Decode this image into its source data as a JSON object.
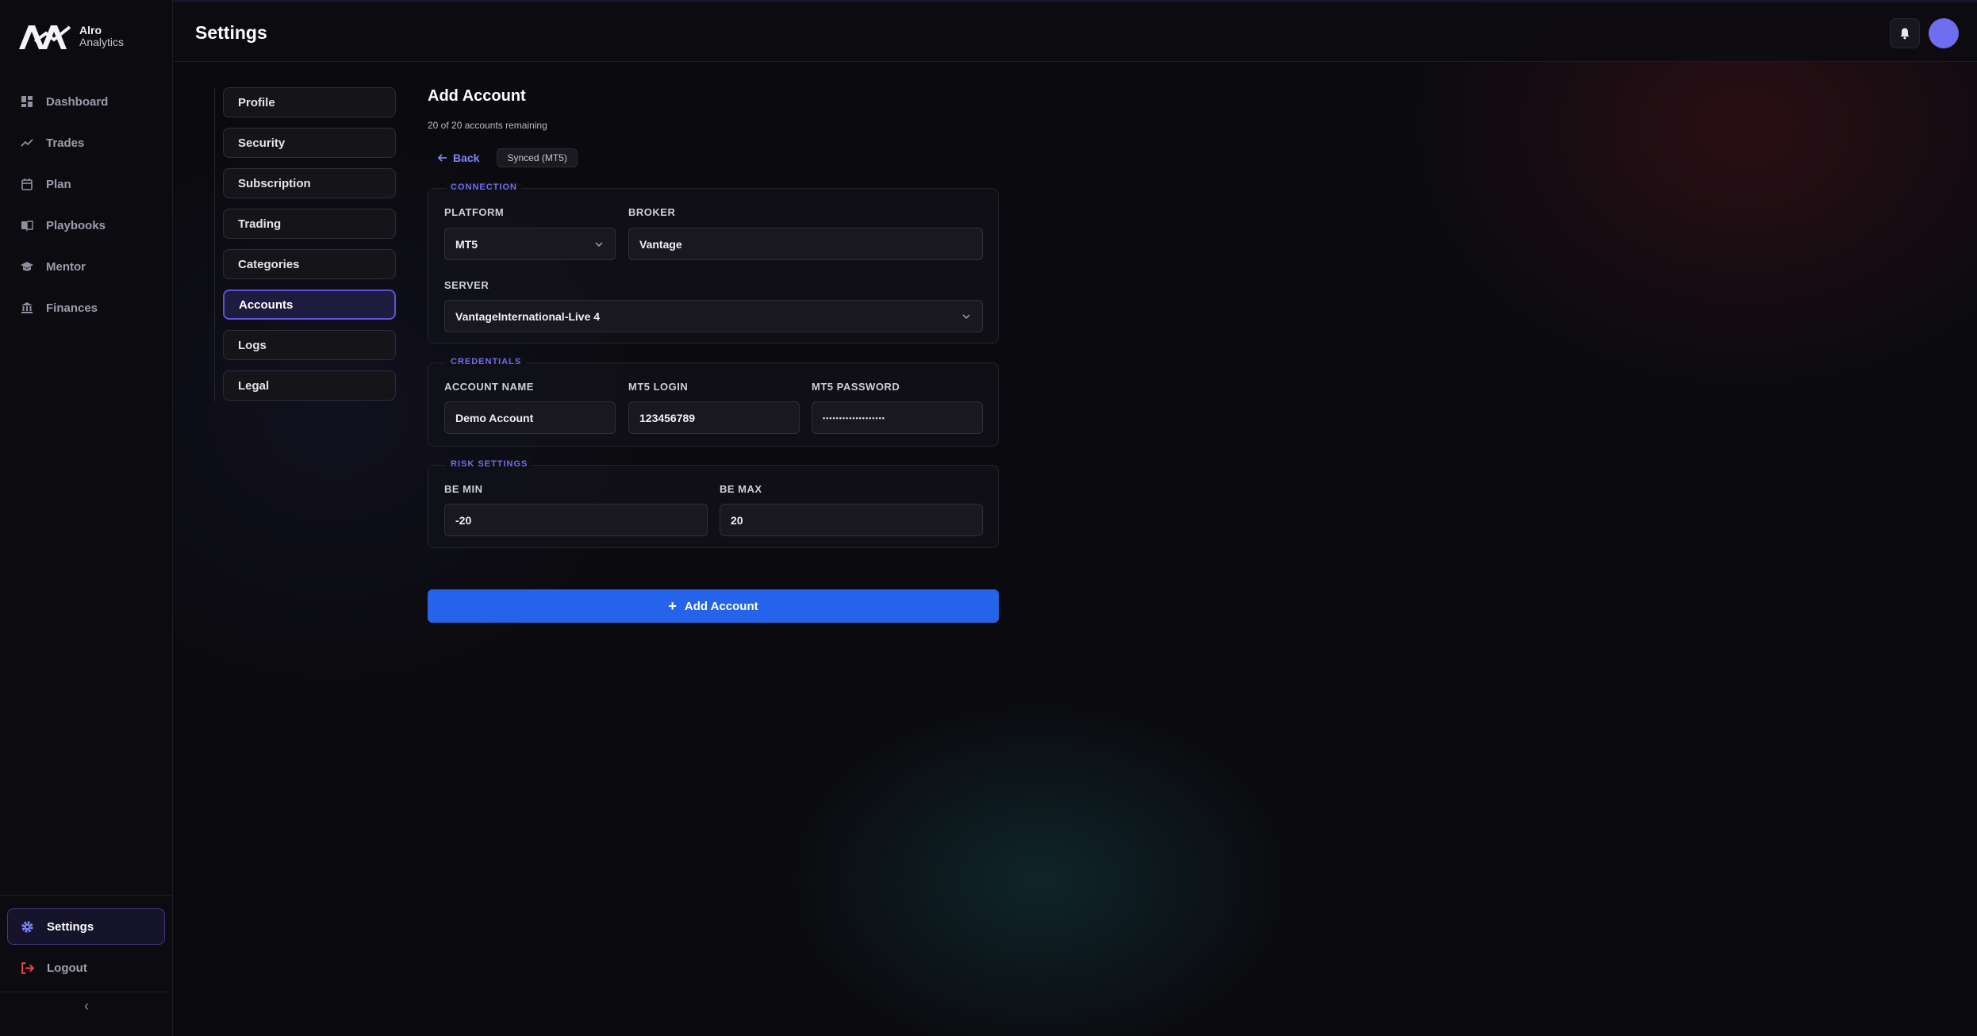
{
  "app": {
    "logo_line1": "Alro",
    "logo_line2": "Analytics",
    "page_title": "Settings"
  },
  "sidebar": {
    "items": [
      {
        "label": "Dashboard",
        "icon": "dashboard-icon"
      },
      {
        "label": "Trades",
        "icon": "trend-icon"
      },
      {
        "label": "Plan",
        "icon": "calendar-icon"
      },
      {
        "label": "Playbooks",
        "icon": "book-icon"
      },
      {
        "label": "Mentor",
        "icon": "graduation-cap-icon"
      },
      {
        "label": "Finances",
        "icon": "bank-icon"
      }
    ],
    "settings_label": "Settings",
    "logout_label": "Logout",
    "collapse_glyph": "‹"
  },
  "settings_nav": {
    "tabs": [
      "Profile",
      "Security",
      "Subscription",
      "Trading",
      "Categories",
      "Accounts",
      "Logs",
      "Legal"
    ],
    "active": "Accounts"
  },
  "form": {
    "title": "Add Account",
    "remaining": "20 of 20 accounts remaining",
    "back_label": "Back",
    "sync_badge": "Synced (MT5)",
    "connection": {
      "legend": "CONNECTION",
      "platform_label": "PLATFORM",
      "platform_value": "MT5",
      "broker_label": "BROKER",
      "broker_value": "Vantage",
      "server_label": "SERVER",
      "server_value": "VantageInternational-Live 4"
    },
    "credentials": {
      "legend": "CREDENTIALS",
      "account_name_label": "ACCOUNT NAME",
      "account_name_value": "Demo Account",
      "login_label": "MT5 LOGIN",
      "login_value": "123456789",
      "password_label": "MT5 PASSWORD",
      "password_value": "•••••••••••••••••••"
    },
    "risk": {
      "legend": "RISK SETTINGS",
      "be_min_label": "BE MIN",
      "be_min_value": "-20",
      "be_max_label": "BE MAX",
      "be_max_value": "20"
    },
    "submit_label": "Add Account"
  },
  "colors": {
    "accent": "#6f6cf2",
    "primary_button": "#2563eb",
    "avatar": "#6f6ef0",
    "logout": "#ef4444"
  }
}
